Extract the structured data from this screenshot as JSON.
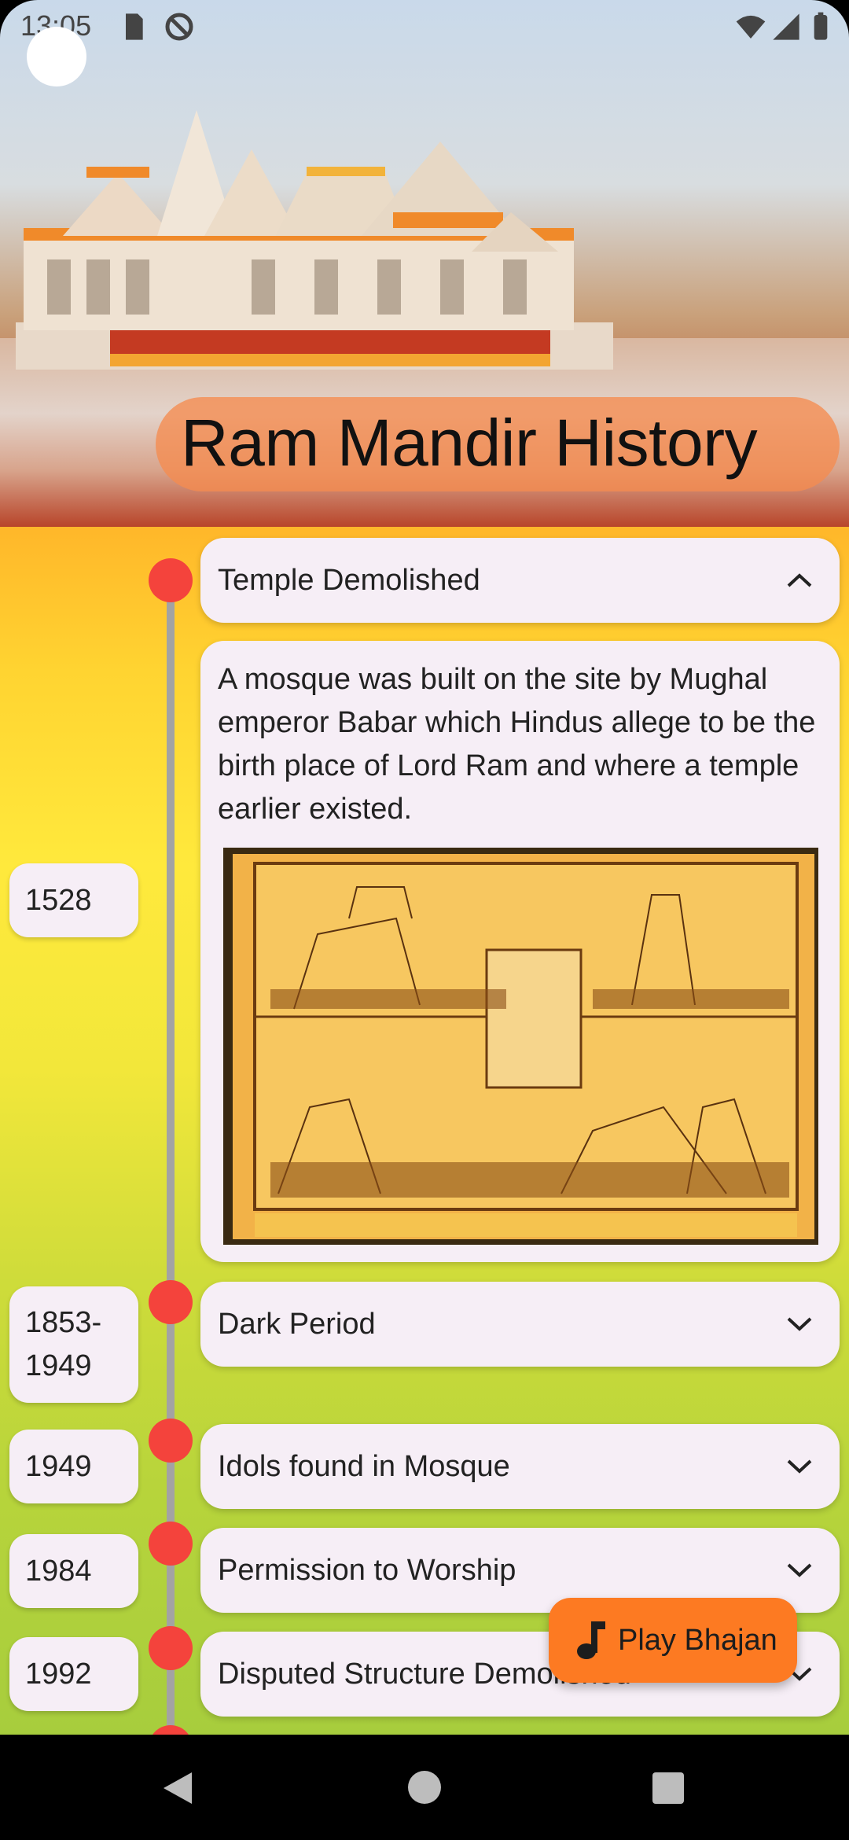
{
  "status_bar": {
    "time": "13:05",
    "icons": [
      "sd-card-icon",
      "sync-disabled-icon",
      "wifi-icon",
      "cell-signal-icon",
      "battery-icon"
    ]
  },
  "header": {
    "title": "Ram Mandir History",
    "image": "ram-mandir-temple-photo"
  },
  "timeline": [
    {
      "year": "1528",
      "title": "Temple Demolished",
      "expanded": true,
      "description": "A mosque was built on the site by Mughal emperor Babar which Hindus allege to be the birth place of Lord Ram and where a temple earlier existed.",
      "image": "historical-sketch-painting"
    },
    {
      "year": "1853-\n1949",
      "title": "Dark Period",
      "expanded": false
    },
    {
      "year": "1949",
      "title": "Idols found in Mosque",
      "expanded": false
    },
    {
      "year": "1984",
      "title": "Permission to Worship",
      "expanded": false
    },
    {
      "year": "1992",
      "title": "Disputed Structure Demolished",
      "expanded": false
    }
  ],
  "fab": {
    "label": "Play Bhajan",
    "icon": "music-note-icon"
  },
  "colors": {
    "accent": "#fd7a22",
    "dot": "#f4433c",
    "card": "#f6eef6",
    "gradient_top": "#ffb72a",
    "gradient_bottom": "#a7cd3d"
  },
  "navbar": {
    "icons": [
      "back-icon",
      "home-icon",
      "recents-icon"
    ]
  }
}
